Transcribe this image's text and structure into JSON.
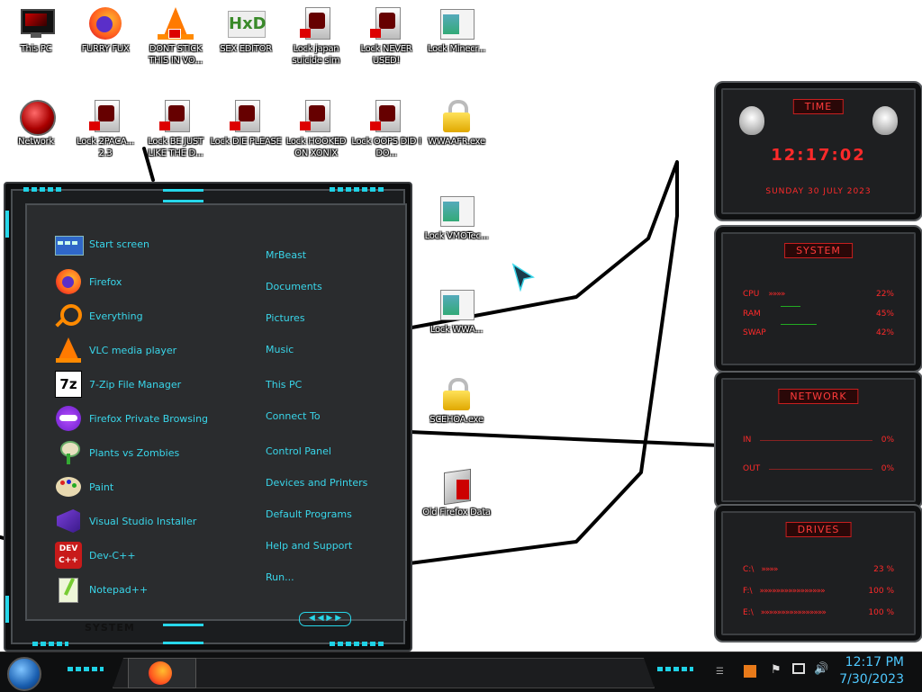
{
  "desktop": {
    "icons": [
      {
        "label": "This PC"
      },
      {
        "label": "FURRY FUX"
      },
      {
        "label": "DONT STICK THIS IN VO..."
      },
      {
        "label": "SEX EDITOR"
      },
      {
        "label": "Lock japan suicide sim"
      },
      {
        "label": "Lock NEVER USED!"
      },
      {
        "label": "Lock Minecr..."
      },
      {
        "label": "Network"
      },
      {
        "label": "Lock 2PACA... 2.3"
      },
      {
        "label": "Lock BE JUST LIKE THE D..."
      },
      {
        "label": "Lock DIE PLEASE"
      },
      {
        "label": "Lock HOOKED ON XONIX"
      },
      {
        "label": "Lock OOPS DID I DO..."
      },
      {
        "label": "WWAAFR.exe"
      },
      {
        "label": "Lock VMOTec..."
      },
      {
        "label": "Lock WWA..."
      },
      {
        "label": "SCEHOA.exe"
      },
      {
        "label": "Old Firefox Data"
      }
    ]
  },
  "start_menu": {
    "apps": [
      {
        "label": "Start screen",
        "icon": "start-screen-icon"
      },
      {
        "label": "Firefox",
        "icon": "firefox-icon"
      },
      {
        "label": "Everything",
        "icon": "everything-search-icon"
      },
      {
        "label": "VLC media player",
        "icon": "vlc-icon"
      },
      {
        "label": "7-Zip File Manager",
        "icon": "7zip-icon"
      },
      {
        "label": "Firefox Private Browsing",
        "icon": "firefox-private-icon"
      },
      {
        "label": "Plants vs Zombies",
        "icon": "plants-vs-zombies-icon"
      },
      {
        "label": "Paint",
        "icon": "paint-icon"
      },
      {
        "label": "Visual Studio Installer",
        "icon": "visual-studio-installer-icon"
      },
      {
        "label": "Dev-C++",
        "icon": "devcpp-icon"
      },
      {
        "label": "Notepad++",
        "icon": "notepadpp-icon"
      }
    ],
    "places": [
      "MrBeast",
      "Documents",
      "Pictures",
      "Music",
      "This PC",
      "Connect To",
      "Control Panel",
      "Devices and Printers",
      "Default Programs",
      "Help and Support",
      "Run..."
    ],
    "system_label": "SYSTEM",
    "seven_zip_glyph": "7z",
    "devcpp_glyph": "DEV C++"
  },
  "gadgets": {
    "time": {
      "title": "TIME",
      "clock": "12:17:02",
      "date": "SUNDAY 30 JULY 2023"
    },
    "system": {
      "title": "SYSTEM",
      "cpu_label": "CPU",
      "cpu_value": "22%",
      "ram_label": "RAM",
      "ram_value": "45%",
      "swap_label": "SWAP",
      "swap_value": "42%"
    },
    "network": {
      "title": "NETWORK",
      "in_label": "IN",
      "in_value": "0%",
      "out_label": "OUT",
      "out_value": "0%"
    },
    "drives": {
      "title": "DRIVES",
      "c_label": "C:\\",
      "c_value": "23 %",
      "f_label": "F:\\",
      "f_value": "100 %",
      "e_label": "E:\\",
      "e_value": "100 %"
    }
  },
  "taskbar": {
    "time": "12:17 PM",
    "date": "7/30/2023"
  },
  "colors": {
    "accent_cyan": "#27d7ea",
    "accent_red": "#ff2a2a",
    "clock_blue": "#4fc9ff"
  }
}
